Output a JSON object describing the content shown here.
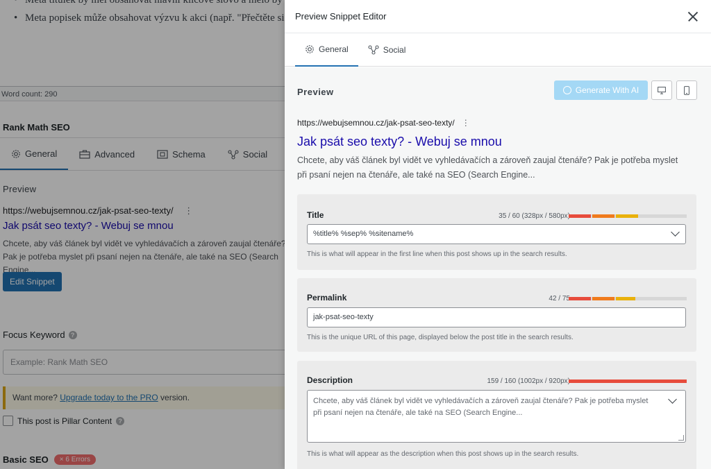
{
  "background": {
    "content_bullets": [
      "Meta titulek by měl obsahovat hlavní klíčové slovo a mělo by být na začátku.",
      "Meta popisek může obsahovat výzvu k akci (např. \"Přečtěte si více\")."
    ],
    "word_count": "Word count: 290",
    "rank_math_title": "Rank Math SEO",
    "tabs": [
      "General",
      "Advanced",
      "Schema",
      "Social"
    ],
    "preview_label": "Preview",
    "serp_url": "https://webujsemnou.cz/jak-psat-seo-texty/",
    "serp_title": "Jak psát seo texty? - Webuj se mnou",
    "serp_desc": "Chcete, aby váš článek byl vidět ve vyhledávačích a zároveň zaujal čtenáře? Pak je potřeba myslet při psaní nejen na čtenáře, ale také na SEO (Search Engine...",
    "edit_snippet": "Edit Snippet",
    "focus_keyword_label": "Focus Keyword",
    "focus_keyword_placeholder": "Example: Rank Math SEO",
    "notice_prefix": "Want more?",
    "notice_link": "Upgrade today to the PRO",
    "notice_suffix": "version.",
    "pillar_label": "This post is Pillar Content",
    "basic_seo": "Basic SEO",
    "errors_badge": "× 6 Errors"
  },
  "panel": {
    "title": "Preview Snippet Editor",
    "tabs": [
      "General",
      "Social"
    ],
    "preview_label": "Preview",
    "ai_button": "Generate With AI",
    "serp_url": "https://webujsemnou.cz/jak-psat-seo-texty/",
    "serp_title": "Jak psát seo texty? - Webuj se mnou",
    "serp_desc": "Chcete, aby váš článek byl vidět ve vyhledávačích a zároveň zaujal čtenáře? Pak je potřeba myslet při psaní nejen na čtenáře, ale také na SEO (Search Engine...",
    "title_field": {
      "label": "Title",
      "count": "35 / 60 (328px / 580px)",
      "value": "%title% %sep% %sitename%",
      "hint": "This is what will appear in the first line when this post shows up in the search results."
    },
    "permalink_field": {
      "label": "Permalink",
      "count": "42 / 75",
      "value": "jak-psat-seo-texty",
      "hint": "This is the unique URL of this page, displayed below the post title in the search results."
    },
    "description_field": {
      "label": "Description",
      "count": "159 / 160 (1002px / 920px)",
      "placeholder": "Chcete, aby váš článek byl vidět ve vyhledávačích a zároveň zaujal čtenáře? Pak je potřeba myslet při psaní nejen na čtenáře, ale také na SEO (Search Engine...",
      "hint": "This is what will appear as the description when this post shows up in the search results."
    },
    "colors": {
      "accent": "#2271b1",
      "meter_red": "#e74c3c",
      "meter_orange": "#f07b1d",
      "meter_yellow": "#e9b10c",
      "serp_title": "#1a0dab"
    }
  }
}
